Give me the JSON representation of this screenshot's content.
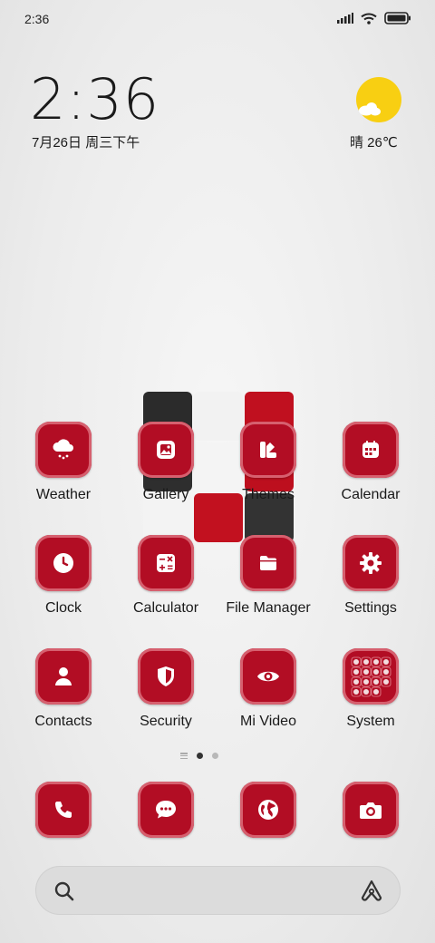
{
  "status_bar": {
    "time": "2:36",
    "icons": [
      "signal-icon",
      "wifi-icon",
      "battery-icon"
    ]
  },
  "clock_widget": {
    "time": "2:36",
    "date": "7月26日 周三下午"
  },
  "weather_widget": {
    "text": "晴 26℃",
    "icon": "sun-cloud-icon"
  },
  "apps": [
    {
      "label": "Weather",
      "icon": "cloud-snow-icon"
    },
    {
      "label": "Gallery",
      "icon": "image-icon"
    },
    {
      "label": "Themes",
      "icon": "theme-icon"
    },
    {
      "label": "Calendar",
      "icon": "calendar-icon"
    },
    {
      "label": "Clock",
      "icon": "clock-icon"
    },
    {
      "label": "Calculator",
      "icon": "calculator-icon"
    },
    {
      "label": "File Manager",
      "icon": "folder-icon"
    },
    {
      "label": "Settings",
      "icon": "gear-icon"
    },
    {
      "label": "Contacts",
      "icon": "person-icon"
    },
    {
      "label": "Security",
      "icon": "shield-icon"
    },
    {
      "label": "Mi Video",
      "icon": "eye-icon"
    },
    {
      "label": "System",
      "icon": "folder-grid-icon"
    }
  ],
  "dock": [
    {
      "icon": "phone-icon"
    },
    {
      "icon": "message-icon"
    },
    {
      "icon": "globe-icon"
    },
    {
      "icon": "camera-icon"
    }
  ],
  "page_indicator": {
    "pages": 2,
    "current": 1
  },
  "colors": {
    "icon_red": "#b20d24",
    "icon_border": "#d6606f",
    "sun_yellow": "#f8cf12"
  }
}
